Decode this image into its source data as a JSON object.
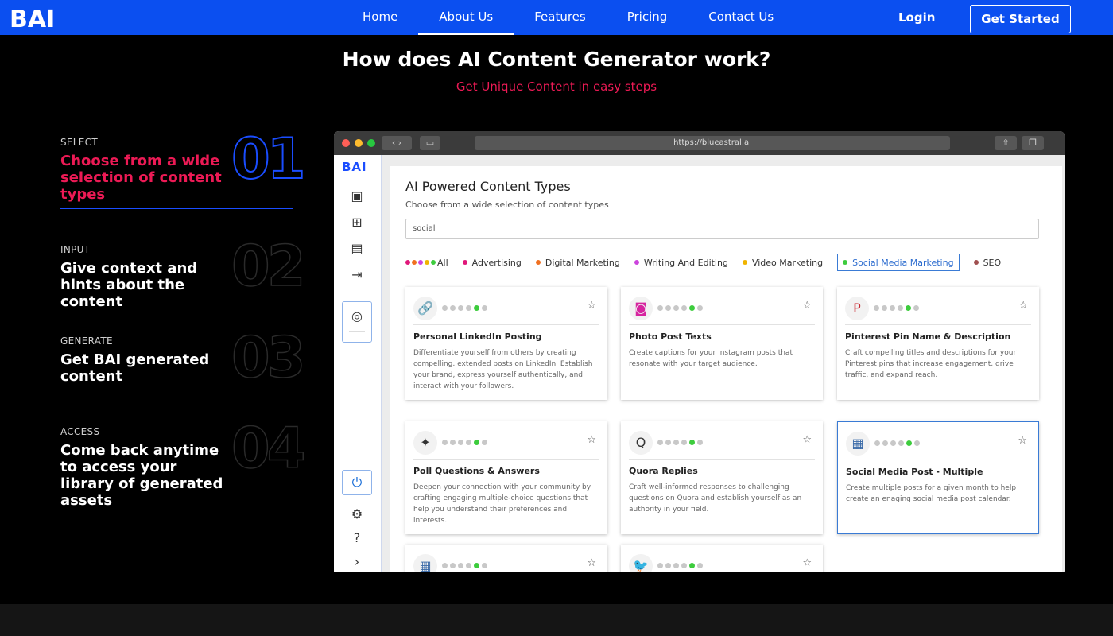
{
  "nav": {
    "logo": "BAI",
    "links": [
      "Home",
      "About Us",
      "Features",
      "Pricing",
      "Contact Us"
    ],
    "active": "About Us",
    "login": "Login",
    "get_started": "Get Started",
    "brand_color": "#0b4ff0"
  },
  "hero": {
    "title": "How does AI Content Generator work?",
    "subtitle": "Get Unique Content in easy steps",
    "accent_color": "#ec1a55"
  },
  "steps": [
    {
      "label": "SELECT",
      "title": "Choose from a wide selection of content types",
      "num": "01",
      "active": true
    },
    {
      "label": "INPUT",
      "title": "Give context and hints about the content",
      "num": "02",
      "active": false
    },
    {
      "label": "GENERATE",
      "title": "Get BAI generated content",
      "num": "03",
      "active": false
    },
    {
      "label": "ACCESS",
      "title": "Come back anytime to access your library of generated assets",
      "num": "04",
      "active": false
    }
  ],
  "browser": {
    "url": "https://blueastral.ai",
    "app_logo": "BAI",
    "sidebar_icons": [
      "layout-icon",
      "apps-icon",
      "save-icon",
      "logout-icon",
      "chat-icon",
      "power-icon",
      "settings-icon",
      "help-icon",
      "chevron-right-icon"
    ],
    "main_title": "AI Powered Content Types",
    "main_subtitle": "Choose from a wide selection of content types",
    "search_value": "social",
    "filters": [
      {
        "label": "All",
        "color": "#e0177a"
      },
      {
        "label": "Advertising",
        "color": "#e0177a"
      },
      {
        "label": "Digital Marketing",
        "color": "#f07020"
      },
      {
        "label": "Writing And Editing",
        "color": "#cc44dd"
      },
      {
        "label": "Video Marketing",
        "color": "#f0b400"
      },
      {
        "label": "Social Media Marketing",
        "color": "#3dcc3d",
        "selected": true
      },
      {
        "label": "SEO",
        "color": "#a05050"
      }
    ],
    "cards": [
      {
        "title": "Personal LinkedIn Posting",
        "desc": "Differentiate yourself from others by creating compelling, extended posts on LinkedIn. Establish your brand, express yourself authentically, and interact with your followers.",
        "icon": "link-icon"
      },
      {
        "title": "Photo Post Texts",
        "desc": "Create captions for your Instagram posts that resonate with your target audience.",
        "icon": "instagram-icon"
      },
      {
        "title": "Pinterest Pin Name & Description",
        "desc": "Craft compelling titles and descriptions for your Pinterest pins that increase engagement, drive traffic, and expand reach.",
        "icon": "pinterest-icon"
      },
      {
        "title": "Poll Questions & Answers",
        "desc": "Deepen your connection with your community by crafting engaging multiple-choice questions that help you understand their preferences and interests.",
        "icon": "poll-icon"
      },
      {
        "title": "Quora Replies",
        "desc": "Craft well-informed responses to challenging questions on Quora and establish yourself as an authority in your field.",
        "icon": "quora-icon"
      },
      {
        "title": "Social Media Post - Multiple",
        "desc": "Create multiple posts for a given month to help create an enaging social media post calendar.",
        "icon": "press-icon",
        "highlight": true
      },
      {
        "title": "",
        "desc": "",
        "icon": "press-icon"
      },
      {
        "title": "",
        "desc": "",
        "icon": "twitter-icon"
      }
    ]
  }
}
